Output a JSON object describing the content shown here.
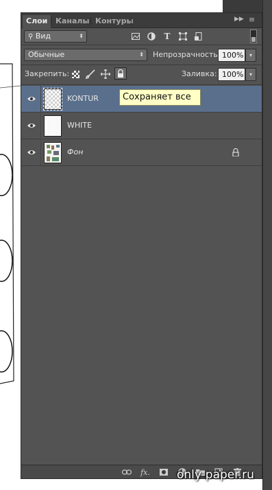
{
  "panel": {
    "tabs": [
      {
        "label": "Слои",
        "active": true
      },
      {
        "label": "Каналы",
        "active": false
      },
      {
        "label": "Контуры",
        "active": false
      }
    ],
    "filter": {
      "kind_label": "Вид"
    },
    "blend_mode": "Обычные",
    "opacity": {
      "label": "Непрозрачность:",
      "value": "100%"
    },
    "lock": {
      "label": "Закрепить:"
    },
    "fill": {
      "label": "Заливка:",
      "value": "100%"
    },
    "tooltip": "Сохраняет все",
    "layers": [
      {
        "name": "KONTUR",
        "selected": true,
        "thumbnail": "transparent-checker",
        "locked": false
      },
      {
        "name": "WHITE",
        "selected": false,
        "thumbnail": "white",
        "locked": false
      },
      {
        "name": "Фон",
        "selected": false,
        "thumbnail": "image",
        "locked": true
      }
    ],
    "footer_icons": [
      "link-icon",
      "fx-icon",
      "mask-icon",
      "adjustment-icon",
      "folder-icon",
      "new-layer-icon",
      "trash-icon"
    ]
  },
  "colors": {
    "panel_bg": "#535353",
    "selected_layer": "#5a6f8c",
    "tooltip_bg": "#ffffc6"
  },
  "watermark": "only-paper.ru"
}
